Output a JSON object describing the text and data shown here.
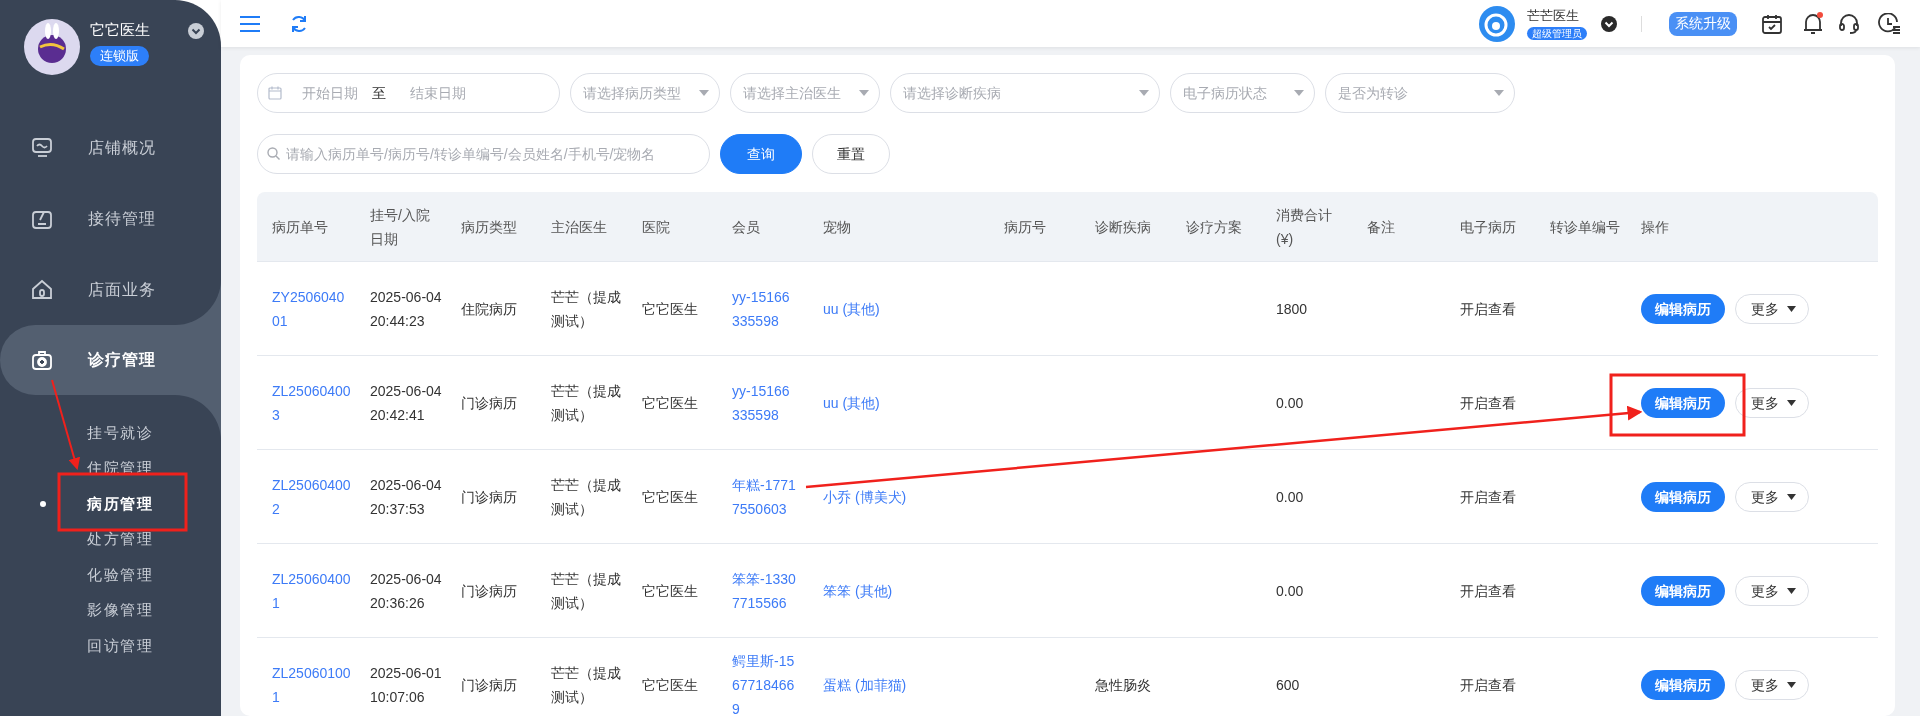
{
  "sidebar": {
    "brand": "它它医生",
    "edition": "连锁版",
    "items": [
      {
        "label": "店铺概况",
        "selected": false
      },
      {
        "label": "接待管理",
        "selected": false
      },
      {
        "label": "店面业务",
        "selected": false
      },
      {
        "label": "诊疗管理",
        "selected": true,
        "children": [
          {
            "label": "挂号就诊",
            "selected": false
          },
          {
            "label": "住院管理",
            "selected": false
          },
          {
            "label": "病历管理",
            "selected": true
          },
          {
            "label": "处方管理",
            "selected": false
          },
          {
            "label": "化验管理",
            "selected": false
          },
          {
            "label": "影像管理",
            "selected": false
          },
          {
            "label": "回访管理",
            "selected": false
          }
        ]
      }
    ]
  },
  "header": {
    "user": "芒芒医生",
    "role": "超级管理员",
    "upgrade_button": "系统升级",
    "has_notification": true
  },
  "filters": {
    "date_start": {
      "placeholder": "开始日期"
    },
    "range_separator": "至",
    "date_end": {
      "placeholder": "结束日期"
    },
    "selects": [
      {
        "placeholder": "请选择病历类型"
      },
      {
        "placeholder": "请选择主治医生"
      },
      {
        "placeholder": "请选择诊断疾病"
      },
      {
        "placeholder": "电子病历状态"
      },
      {
        "placeholder": "是否为转诊"
      }
    ],
    "search": {
      "placeholder": "请输入病历单号/病历号/转诊单编号/会员姓名/手机号/宠物名"
    },
    "buttons": [
      "查询",
      "重置"
    ]
  },
  "table": {
    "columns": [
      "病历单号",
      "挂号/入院日期",
      "病历类型",
      "主治医生",
      "医院",
      "会员",
      "宠物",
      "病历号",
      "诊断疾病",
      "诊疗方案",
      "消费合计(¥)",
      "备注",
      "电子病历",
      "转诊单编号",
      "操作"
    ],
    "rows": [
      {
        "record_id": "ZY250604001",
        "date": "2025-06-04 20:44:23",
        "type": "住院病历",
        "doctor": "芒芒（提成测试）",
        "hospital": "它它医生",
        "member": "yy-15166335598",
        "pet": "uu (其他)",
        "total": "1800",
        "emr": "开启查看",
        "actions": [
          "编辑病历",
          "更多"
        ]
      },
      {
        "record_id": "ZL250604003",
        "date": "2025-06-04 20:42:41",
        "type": "门诊病历",
        "doctor": "芒芒（提成测试）",
        "hospital": "它它医生",
        "member": "yy-15166335598",
        "pet": "uu (其他)",
        "total": "0.00",
        "emr": "开启查看",
        "actions": [
          "编辑病历",
          "更多"
        ]
      },
      {
        "record_id": "ZL250604002",
        "date": "2025-06-04 20:37:53",
        "type": "门诊病历",
        "doctor": "芒芒（提成测试）",
        "hospital": "它它医生",
        "member": "年糕-17717550603",
        "pet": "小乔 (博美犬)",
        "total": "0.00",
        "emr": "开启查看",
        "actions": [
          "编辑病历",
          "更多"
        ]
      },
      {
        "record_id": "ZL250604001",
        "date": "2025-06-04 20:36:26",
        "type": "门诊病历",
        "doctor": "芒芒（提成测试）",
        "hospital": "它它医生",
        "member": "笨笨-13307715566",
        "pet": "笨笨 (其他)",
        "total": "0.00",
        "emr": "开启查看",
        "actions": [
          "编辑病历",
          "更多"
        ]
      },
      {
        "record_id": "ZL250601001",
        "date": "2025-06-01 10:07:06",
        "type": "门诊病历",
        "doctor": "芒芒（提成测试）",
        "hospital": "它它医生",
        "member": "鳄里斯-15677184669",
        "pet": "蛋糕 (加菲猫)",
        "diagnosis": "急性肠炎",
        "total": "600",
        "emr": "开启查看",
        "actions": [
          "编辑病历",
          "更多"
        ]
      }
    ]
  }
}
